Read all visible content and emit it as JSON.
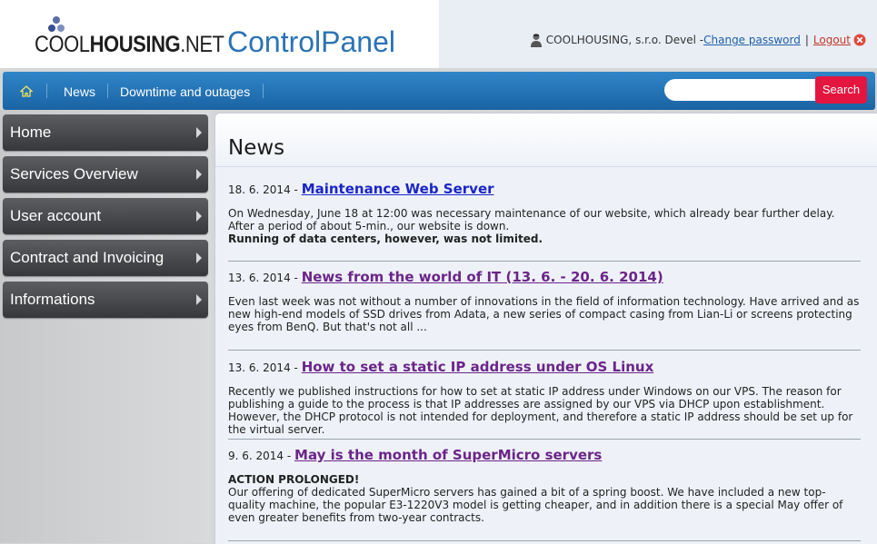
{
  "header": {
    "logo_light": "COOL",
    "logo_bold": "HOUSING",
    "logo_suffix": ".NET",
    "app_title": "ControlPanel",
    "user_label": "COOLHOUSING, s.r.o. Devel -",
    "change_password": "Change password",
    "separator": "|",
    "logout": "Logout",
    "user_icon": "user-icon",
    "logout_icon": "close-circle-icon"
  },
  "nav": {
    "home_icon": "home-icon",
    "items": [
      {
        "label": "News"
      },
      {
        "label": "Downtime and outages"
      }
    ],
    "search": {
      "placeholder": "",
      "value": "",
      "button_label": "Search"
    }
  },
  "sidebar": {
    "items": [
      {
        "label": "Home"
      },
      {
        "label": "Services Overview"
      },
      {
        "label": "User account"
      },
      {
        "label": "Contract and Invoicing"
      },
      {
        "label": "Informations"
      }
    ]
  },
  "main": {
    "title": "News",
    "articles": [
      {
        "date": "18. 6. 2014 -",
        "title": "Maintenance Web Server ",
        "body": "On Wednesday, June 18 at 12:00 was necessary maintenance of our website, which already bear further delay. After a period of about 5-min., our website is down.",
        "bold": "Running of data centers, however, was not limited."
      },
      {
        "date": "13. 6. 2014 -",
        "title": "News from the world of IT (13. 6. - 20. 6. 2014)",
        "body": "Even last week was not without a number of innovations in the field of information technology. Have arrived and as new high-end models of SSD drives from Adata, a new series of compact casing from Lian-Li or screens protecting eyes from BenQ. But that's not all ..."
      },
      {
        "date": "13. 6. 2014 -",
        "title": "How to set a static IP address under OS Linux",
        "body": "Recently we published instructions for how to set at static IP address under Windows on our VPS. The reason for publishing a guide to the process is that IP addresses are assigned by our VPS via DHCP upon establishment. However, the DHCP protocol is not intended for deployment, and therefore a static IP address should be set up for the virtual server."
      },
      {
        "date": "9. 6. 2014 -",
        "title": "May is the month of SuperMicro servers",
        "bold": "ACTION PROLONGED!",
        "body": "Our offering of dedicated SuperMicro servers has gained a bit of a spring boost. We have included a new top-quality machine, the popular E3-1220V3 model is getting cheaper, and in addition there is a special May offer of even greater benefits from two-year contracts."
      }
    ]
  },
  "colors": {
    "nav_blue": "#1f6fb5",
    "search_red": "#e4163f",
    "link_unvisited": "#1a25c9",
    "link_visited": "#6b2589"
  }
}
